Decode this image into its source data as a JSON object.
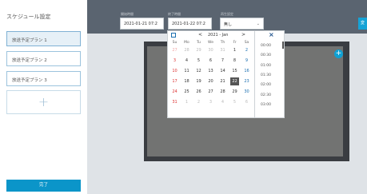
{
  "sidebar": {
    "title": "スケジュール設定",
    "plans": [
      "放送予定プラン 1",
      "放送予定プラン 2",
      "放送予定プラン 3"
    ],
    "add_label": "+",
    "done_label": "完了"
  },
  "toolbar": {
    "start_label": "開始時間",
    "start_value": "2021-01-21 07:2",
    "end_label": "終了時間",
    "end_value": "2021-01-22 07:2",
    "repeat_label": "再生設定",
    "repeat_value": "無し",
    "right_button": "変"
  },
  "calendar": {
    "title": "2021 - Jan",
    "prev": "<",
    "next": ">",
    "close": "×",
    "weekdays": [
      "Su",
      "Mo",
      "Tu",
      "We",
      "Th",
      "Fr",
      "Sa"
    ],
    "weeks": [
      [
        "27",
        "28",
        "29",
        "30",
        "31",
        "1",
        "2"
      ],
      [
        "3",
        "4",
        "5",
        "6",
        "7",
        "8",
        "9"
      ],
      [
        "10",
        "11",
        "12",
        "13",
        "14",
        "15",
        "16"
      ],
      [
        "17",
        "18",
        "19",
        "20",
        "21",
        "22",
        "23"
      ],
      [
        "24",
        "25",
        "26",
        "27",
        "28",
        "29",
        "30"
      ],
      [
        "31",
        "1",
        "2",
        "3",
        "4",
        "5",
        "6"
      ]
    ],
    "selected": "22"
  },
  "times": [
    "00:00",
    "00:30",
    "01:00",
    "01:30",
    "02:00",
    "02:30",
    "03:00"
  ],
  "colors": {
    "accent": "#0b95c9",
    "topbar": "#5a6470",
    "frame": "#3a3d42"
  }
}
